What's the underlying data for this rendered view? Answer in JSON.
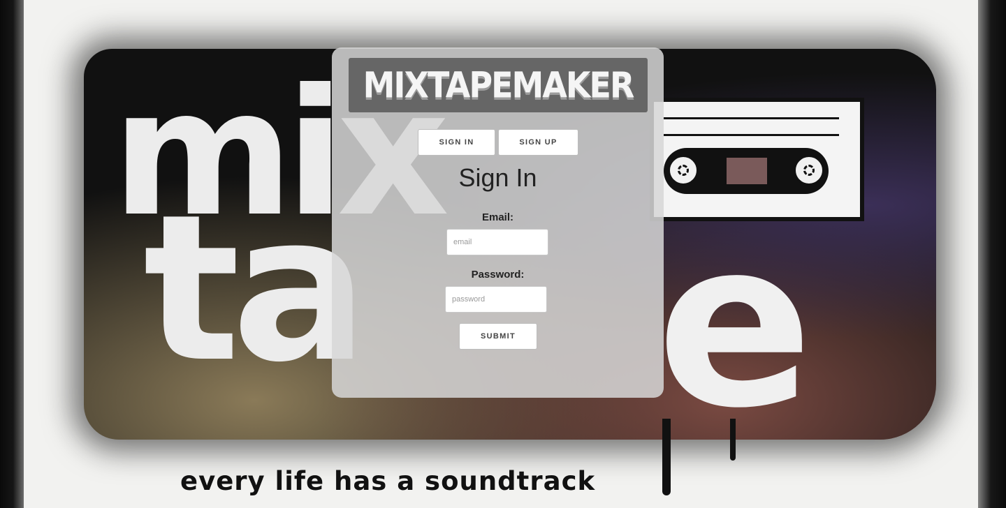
{
  "app": {
    "logo_text": "MIXTAPEMAKER"
  },
  "background": {
    "tagline": "every life has a soundtrack"
  },
  "auth_tabs": {
    "sign_in_label": "SIGN IN",
    "sign_up_label": "SIGN UP"
  },
  "form": {
    "heading": "Sign In",
    "email_label": "Email:",
    "email_placeholder": "email",
    "email_value": "",
    "password_label": "Password:",
    "password_placeholder": "password",
    "password_value": "",
    "submit_label": "SUBMIT"
  }
}
